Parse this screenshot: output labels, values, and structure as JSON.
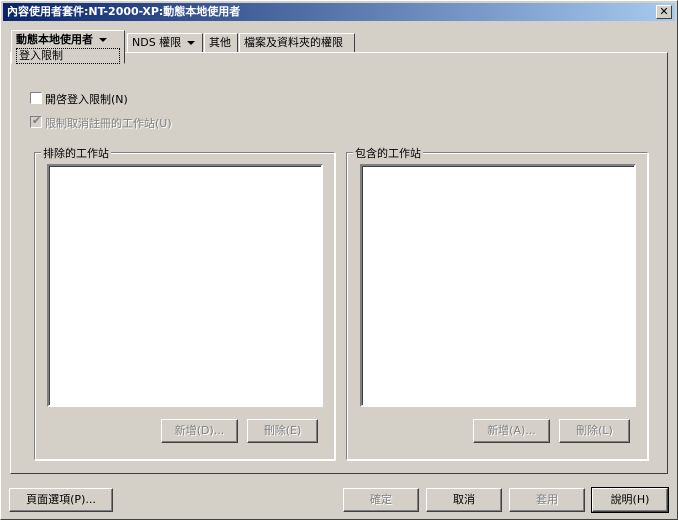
{
  "window": {
    "title": "內容使用者套件:NT-2000-XP:動態本地使用者",
    "close_glyph": "✕"
  },
  "tabs": [
    {
      "label": "動態本地使用者",
      "sub": "登入限制",
      "active": true,
      "dropdown": true
    },
    {
      "label": "NDS 權限",
      "dropdown": true
    },
    {
      "label": "其他"
    },
    {
      "label": "檔案及資料夾的權限"
    }
  ],
  "options": {
    "enable_login_restrictions": {
      "label": "開啓登入限制(N)",
      "checked": false
    },
    "restrict_deregistered": {
      "label": "限制取消註冊的工作站(U)",
      "checked": true,
      "disabled": true
    }
  },
  "excluded": {
    "title": "排除的工作站",
    "add_label": "新增(D)...",
    "remove_label": "刪除(E)"
  },
  "included": {
    "title": "包含的工作站",
    "add_label": "新增(A)...",
    "remove_label": "刪除(L)"
  },
  "footer": {
    "page_options": "頁面選項(P)...",
    "ok": "確定",
    "cancel": "取消",
    "apply": "套用",
    "help": "說明(H)"
  }
}
